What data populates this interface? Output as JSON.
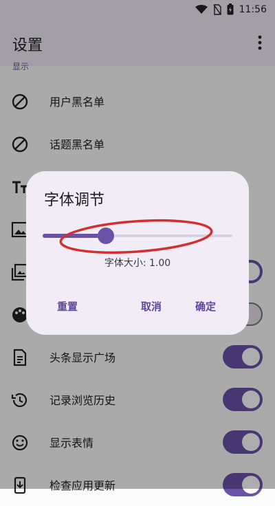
{
  "status": {
    "time": "11:56"
  },
  "appbar": {
    "title": "设置",
    "menu_icon": "more-vert-icon"
  },
  "section_label": "显示",
  "rows": [
    {
      "label": "用户黑名单",
      "icon": "block-icon"
    },
    {
      "label": "话题黑名单",
      "icon": "block-icon"
    },
    {
      "label": "",
      "icon": "text-size-icon"
    },
    {
      "label": "",
      "icon": "image-icon",
      "toggle": "on"
    },
    {
      "label": "",
      "icon": "images-icon",
      "toggle": "on"
    },
    {
      "label": "",
      "icon": "palette-icon",
      "toggle": "off"
    },
    {
      "label": "头条显示广场",
      "icon": "article-icon",
      "toggle": "on"
    },
    {
      "label": "记录浏览历史",
      "icon": "history-icon",
      "toggle": "on"
    },
    {
      "label": "显示表情",
      "icon": "emoji-icon",
      "toggle": "on"
    },
    {
      "label": "检查应用更新",
      "icon": "update-icon",
      "toggle": "on"
    }
  ],
  "dialog": {
    "title": "字体调节",
    "slider": {
      "value": 1.0,
      "min": 0.5,
      "max": 2.0
    },
    "size_text": "字体大小: 1.00",
    "reset": "重置",
    "cancel": "取消",
    "confirm": "确定"
  },
  "colors": {
    "accent": "#6b52a8",
    "annotation": "#d32f2f"
  }
}
